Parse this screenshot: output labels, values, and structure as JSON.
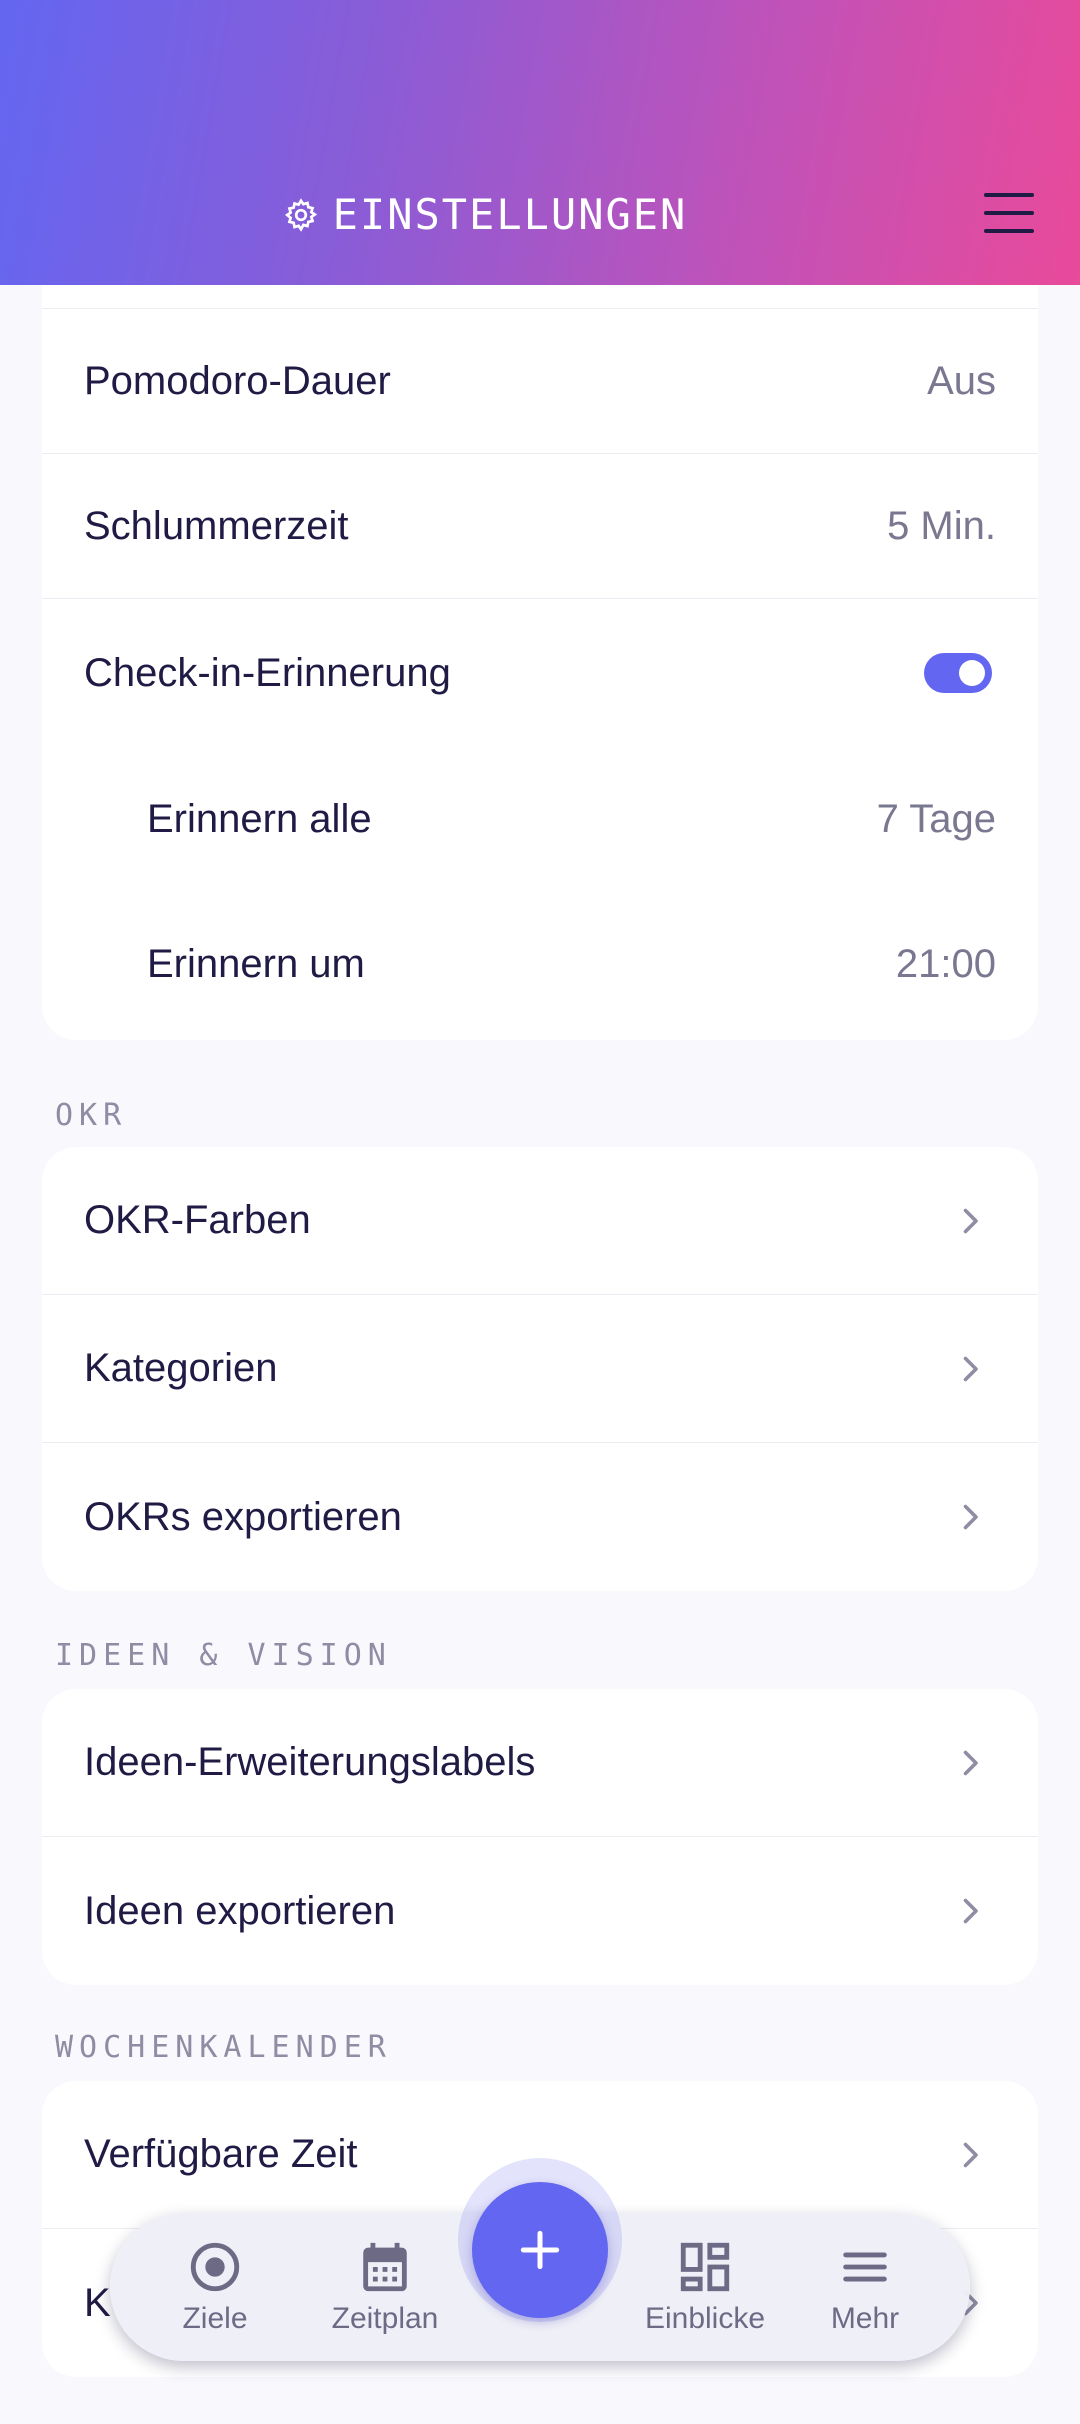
{
  "header": {
    "title": "EINSTELLUNGEN"
  },
  "timer_card": {
    "pomodoro": {
      "label": "Pomodoro-Dauer",
      "value": "Aus"
    },
    "snooze": {
      "label": "Schlummerzeit",
      "value": "5 Min."
    },
    "checkin": {
      "label": "Check-in-Erinnerung",
      "enabled": true
    },
    "remind_every": {
      "label": "Erinnern alle",
      "value": "7 Tage"
    },
    "remind_at": {
      "label": "Erinnern um",
      "value": "21:00"
    }
  },
  "okr": {
    "title": "OKR",
    "items": [
      "OKR-Farben",
      "Kategorien",
      "OKRs exportieren"
    ]
  },
  "ideas": {
    "title": "IDEEN & VISION",
    "items": [
      "Ideen-Erweiterungslabels",
      "Ideen exportieren"
    ]
  },
  "week": {
    "title": "WOCHENKALENDER",
    "items": [
      "Verfügbare Zeit",
      "K"
    ]
  },
  "bottom_nav": {
    "goals": "Ziele",
    "schedule": "Zeitplan",
    "insights": "Einblicke",
    "more": "Mehr"
  },
  "colors": {
    "accent": "#6366f1",
    "gradient_end": "#e94a9a",
    "text": "#1f1b44"
  }
}
